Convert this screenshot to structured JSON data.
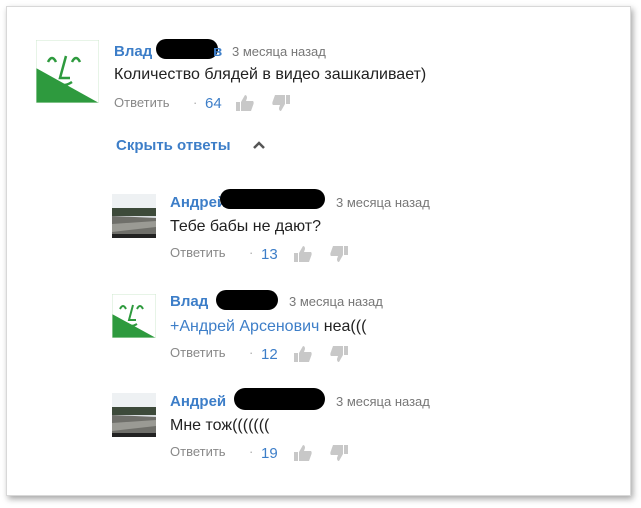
{
  "comments": [
    {
      "author": "Влад",
      "author_tail": "в",
      "time": "3 месяца назад",
      "text": "Количество блядей в видео зашкаливает)",
      "reply_label": "Ответить",
      "likes": "64"
    }
  ],
  "hide_replies_label": "Скрыть ответы",
  "replies": [
    {
      "author": "Андрей",
      "time": "3 месяца назад",
      "text": "Тебе бабы не дают?",
      "reply_label": "Ответить",
      "likes": "13"
    },
    {
      "author": "Влад",
      "time": "3 месяца назад",
      "mention": "+Андрей Арсенович",
      "text": " неа(((",
      "reply_label": "Ответить",
      "likes": "12"
    },
    {
      "author": "Андрей",
      "time": "3 месяца назад",
      "text": "Мне тож(((((((",
      "reply_label": "Ответить",
      "likes": "19"
    }
  ],
  "icons": {
    "like": "thumbs-up-icon",
    "dislike": "thumbs-down-icon",
    "chevron": "chevron-up-icon"
  },
  "colors": {
    "link": "#3d7ec8",
    "avatar_green": "#2e9a3e",
    "meta": "#777777"
  }
}
